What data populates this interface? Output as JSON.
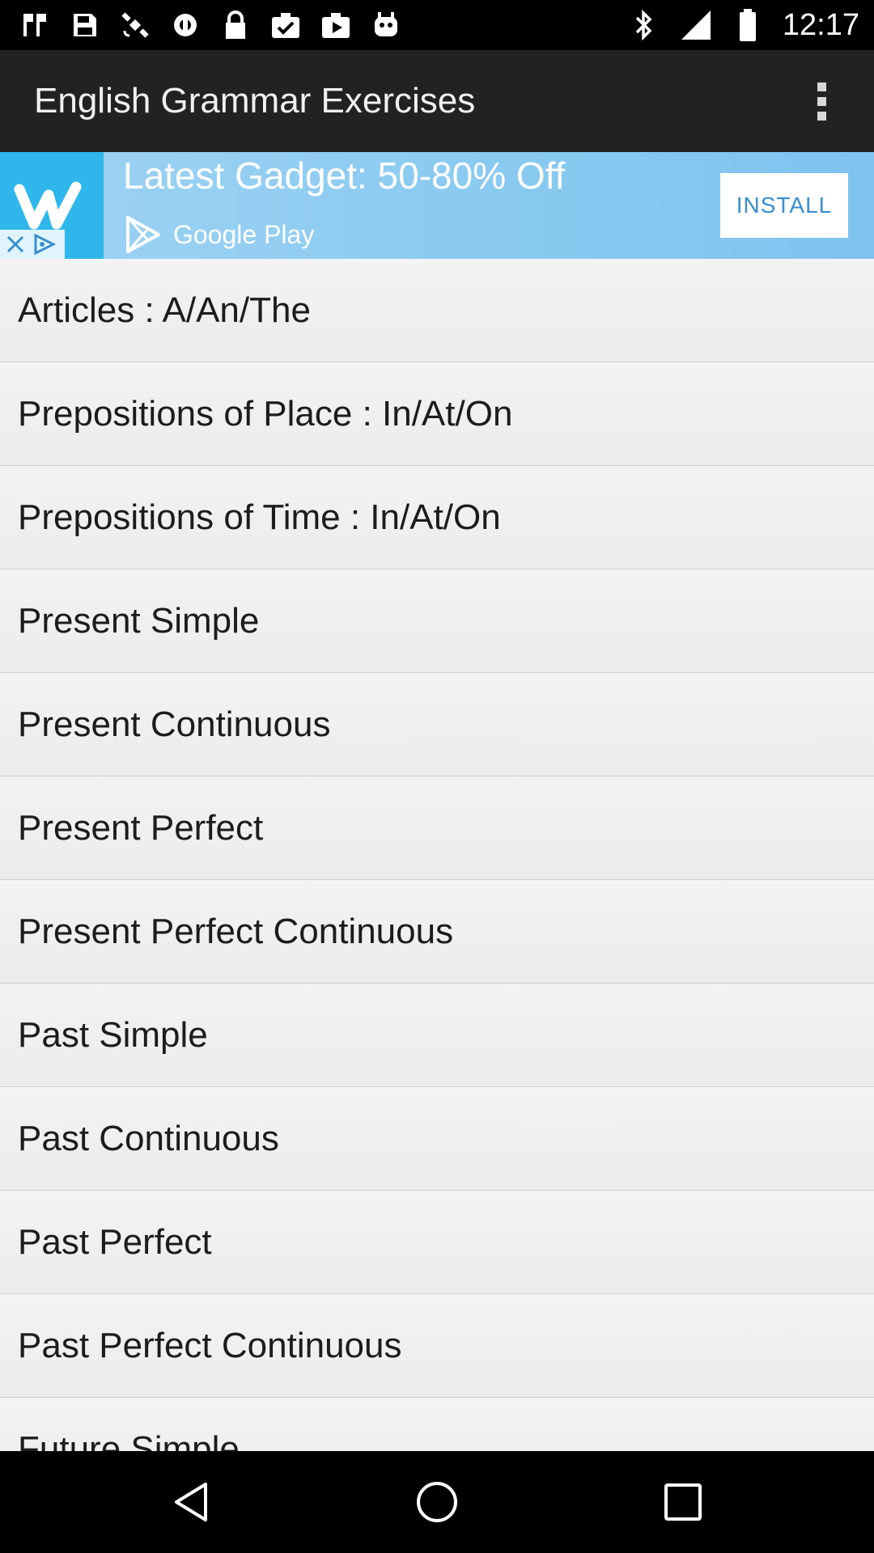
{
  "status_bar": {
    "time": "12:17",
    "left_icons": [
      "fake-gps-icon",
      "save-icon",
      "satellite-icon",
      "sync-icon",
      "lock-icon",
      "checklist-icon",
      "play-store-icon",
      "robot-icon"
    ],
    "right_icons": [
      "bluetooth-icon",
      "signal-icon",
      "battery-icon"
    ]
  },
  "app_bar": {
    "title": "English Grammar Exercises",
    "menu_icon": "overflow-menu-icon"
  },
  "ad": {
    "headline": "Latest Gadget: 50-80% Off",
    "store": "Google Play",
    "install_label": "INSTALL",
    "logo_letter": "w"
  },
  "list": {
    "items": [
      "Articles : A/An/The",
      "Prepositions of Place : In/At/On",
      "Prepositions of Time : In/At/On",
      "Present Simple",
      "Present Continuous",
      "Present Perfect",
      "Present Perfect Continuous",
      "Past Simple",
      "Past Continuous",
      "Past Perfect",
      "Past Perfect Continuous",
      "Future Simple"
    ]
  },
  "nav_bar": {
    "buttons": [
      "back-icon",
      "home-icon",
      "recents-icon"
    ]
  },
  "colors": {
    "app_bar": "#222222",
    "ad_background": "#8ccbf1",
    "list_background": "#ececec",
    "install_text": "#3a8fd0"
  }
}
